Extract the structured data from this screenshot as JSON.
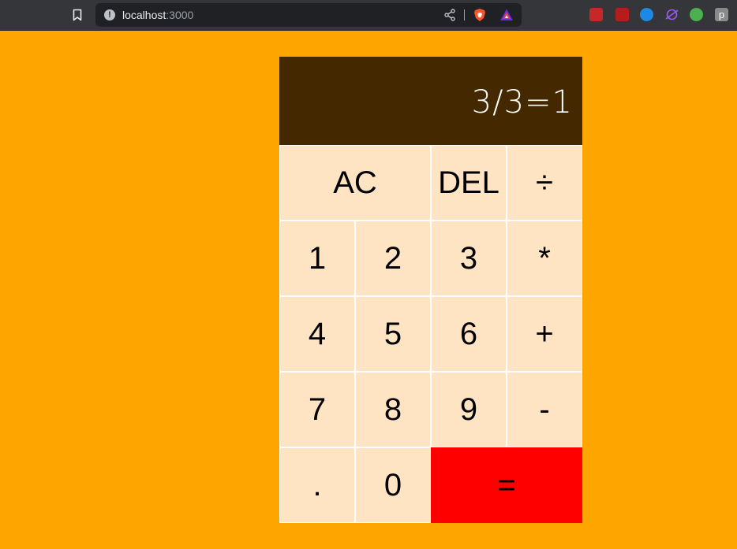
{
  "browser": {
    "url_host": "localhost",
    "url_port": ":3000",
    "extension_p_label": "p"
  },
  "calculator": {
    "display": "3/3=1",
    "buttons": {
      "ac": "AC",
      "del": "DEL",
      "divide": "÷",
      "one": "1",
      "two": "2",
      "three": "3",
      "multiply": "*",
      "four": "4",
      "five": "5",
      "six": "6",
      "plus": "+",
      "seven": "7",
      "eight": "8",
      "nine": "9",
      "minus": "-",
      "dot": ".",
      "zero": "0",
      "equals": "="
    }
  },
  "colors": {
    "page_background": "#ffa500",
    "display_background": "#432800",
    "button_background": "#ffe4c4",
    "equals_background": "#ff0000"
  }
}
